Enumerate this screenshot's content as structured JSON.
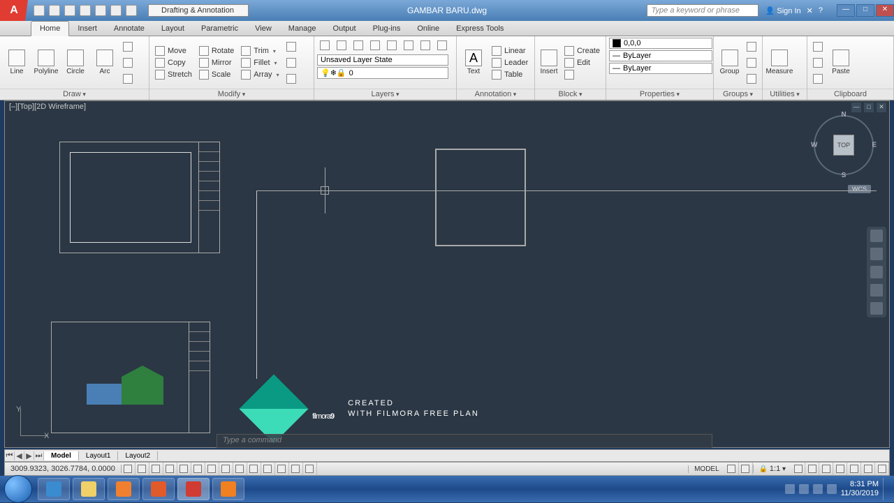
{
  "title": "GAMBAR BARU.dwg",
  "workspace": "Drafting & Annotation",
  "search_placeholder": "Type a keyword or phrase",
  "signin": "Sign In",
  "tabs": [
    "Home",
    "Insert",
    "Annotate",
    "Layout",
    "Parametric",
    "View",
    "Manage",
    "Output",
    "Plug-ins",
    "Online",
    "Express Tools"
  ],
  "active_tab": "Home",
  "panels": {
    "draw": {
      "title": "Draw",
      "tools": [
        "Line",
        "Polyline",
        "Circle",
        "Arc"
      ]
    },
    "modify": {
      "title": "Modify",
      "tools": {
        "move": "Move",
        "rotate": "Rotate",
        "trim": "Trim",
        "copy": "Copy",
        "mirror": "Mirror",
        "fillet": "Fillet",
        "stretch": "Stretch",
        "scale": "Scale",
        "array": "Array"
      }
    },
    "layers": {
      "title": "Layers",
      "state": "Unsaved Layer State",
      "current": "0"
    },
    "annotation": {
      "title": "Annotation",
      "text": "Text",
      "linear": "Linear",
      "leader": "Leader",
      "table": "Table"
    },
    "block": {
      "title": "Block",
      "insert": "Insert",
      "create": "Create",
      "edit": "Edit"
    },
    "properties": {
      "title": "Properties",
      "color": "0,0,0",
      "lw": "ByLayer",
      "lt": "ByLayer"
    },
    "groups": {
      "title": "Groups",
      "group": "Group"
    },
    "utilities": {
      "title": "Utilities",
      "measure": "Measure"
    },
    "clipboard": {
      "title": "Clipboard",
      "paste": "Paste"
    }
  },
  "viewport_label": "[–][Top][2D Wireframe]",
  "viewcube": {
    "top": "TOP",
    "n": "N",
    "s": "S",
    "e": "E",
    "w": "W",
    "wcs": "WCS"
  },
  "ucs": {
    "x": "X",
    "y": "Y"
  },
  "command_prompt": "Type a command",
  "layout_tabs": [
    "Model",
    "Layout1",
    "Layout2"
  ],
  "active_layout": "Model",
  "status": {
    "coords": "3009.9323, 3026.7784, 0.0000",
    "model": "MODEL",
    "scale": "1:1"
  },
  "watermark": {
    "brand": "filmora",
    "num": "9",
    "line1": "CREATED",
    "line2": "WITH FILMORA FREE PLAN"
  },
  "tray": {
    "time": "8:31 PM",
    "date": "11/30/2019"
  }
}
